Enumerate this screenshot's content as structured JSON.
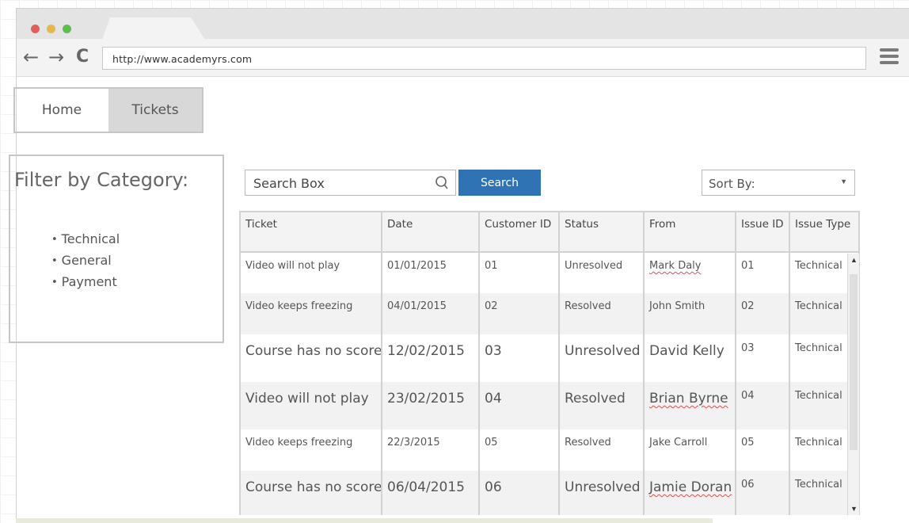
{
  "browser": {
    "url": "http://www.academyrs.com",
    "dot_colors": [
      "#e35d5b",
      "#e4b84a",
      "#5bbf4b"
    ],
    "back_icon": "←",
    "forward_icon": "→",
    "reload_icon": "C"
  },
  "nav": {
    "home_label": "Home",
    "tickets_label": "Tickets",
    "active": "Tickets"
  },
  "filter": {
    "title": "Filter by Category:",
    "categories": [
      "Technical",
      "General",
      "Payment"
    ]
  },
  "search": {
    "placeholder": "Search Box",
    "button_label": "Search",
    "button_color": "#2f73b5"
  },
  "sort": {
    "label": "Sort By:"
  },
  "table": {
    "headers": [
      "Ticket",
      "Date",
      "Customer ID",
      "Status",
      "From",
      "Issue ID",
      "Issue Type"
    ],
    "rows": [
      {
        "ticket": "Video will not play",
        "date": "01/01/2015",
        "customer_id": "01",
        "status": "Unresolved",
        "from": "Mark Daly",
        "issue_id": "01",
        "issue_type": "Technical"
      },
      {
        "ticket": "Video keeps freezing",
        "date": "04/01/2015",
        "customer_id": "02",
        "status": "Resolved",
        "from": "John Smith",
        "issue_id": "02",
        "issue_type": "Technical"
      },
      {
        "ticket": "Course has no score",
        "date": "12/02/2015",
        "customer_id": "03",
        "status": "Unresolved",
        "from": "David Kelly",
        "issue_id": "03",
        "issue_type": "Technical"
      },
      {
        "ticket": "Video will not play",
        "date": "23/02/2015",
        "customer_id": "04",
        "status": "Resolved",
        "from": "Brian Byrne",
        "issue_id": "04",
        "issue_type": "Technical"
      },
      {
        "ticket": "Video keeps freezing",
        "date": "22/3/2015",
        "customer_id": "05",
        "status": "Resolved",
        "from": "Jake Carroll",
        "issue_id": "05",
        "issue_type": "Technical"
      },
      {
        "ticket": "Course has no score",
        "date": "06/04/2015",
        "customer_id": "06",
        "status": "Unresolved",
        "from": "Jamie Doran",
        "issue_id": "06",
        "issue_type": "Technical"
      }
    ]
  }
}
